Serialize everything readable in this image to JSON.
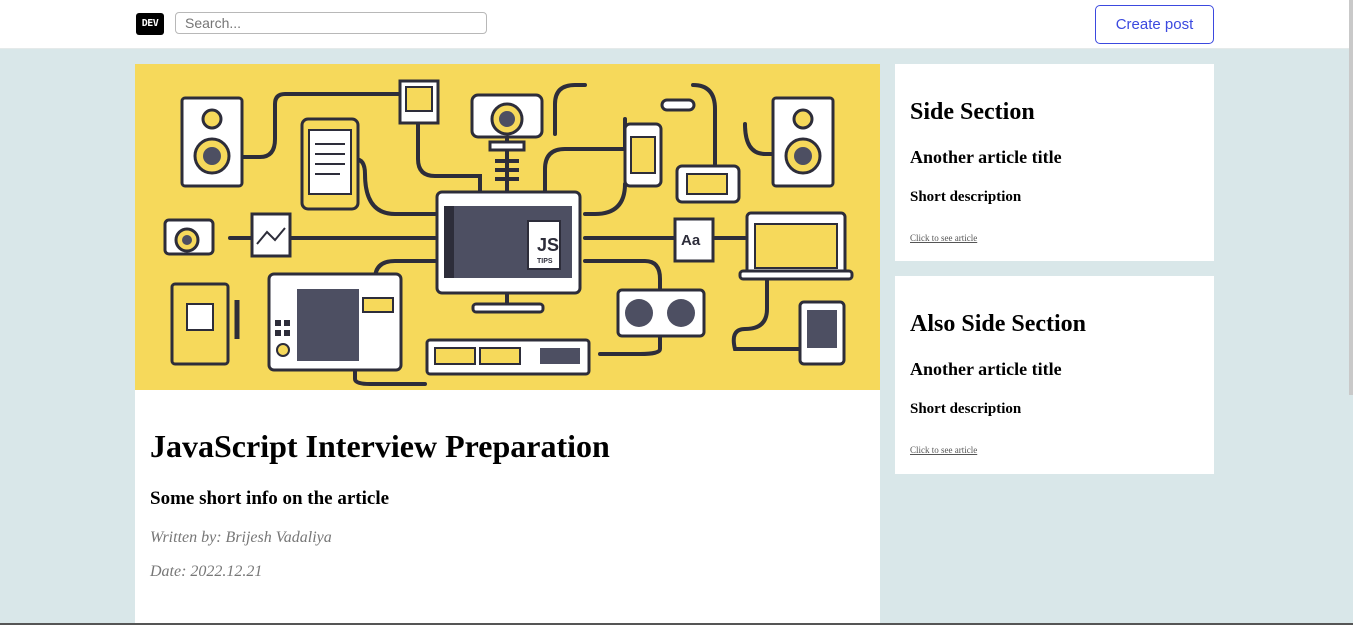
{
  "header": {
    "logo_text": "DEV",
    "search_placeholder": "Search...",
    "create_post_label": "Create post",
    "accent_color": "#3b49df"
  },
  "article": {
    "title": "JavaScript Interview Preparation",
    "subtitle": "Some short info on the article",
    "author": "Written by: Brijesh Vadaliya",
    "date": "Date: 2022.12.21",
    "cover_badge": "JS",
    "cover_badge_small": "TIPS",
    "cover_font_sample": "Aa",
    "cover_color": "#f6d95b"
  },
  "sidebar": [
    {
      "heading": "Side Section",
      "article_title": "Another article title",
      "description": "Short description",
      "link": "Click to see article"
    },
    {
      "heading": "Also Side Section",
      "article_title": "Another article title",
      "description": "Short description",
      "link": "Click to see article"
    }
  ]
}
